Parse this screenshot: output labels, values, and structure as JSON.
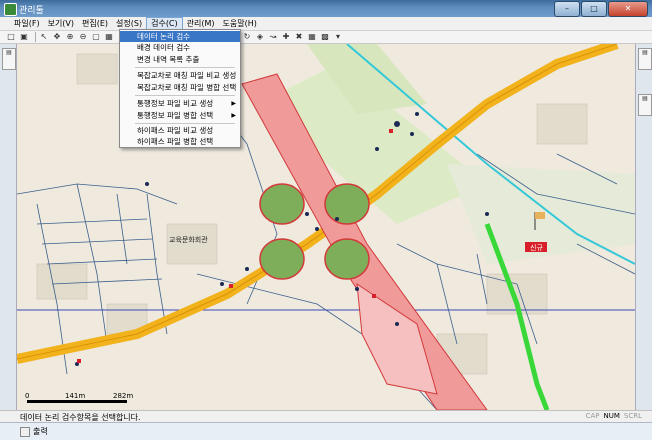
{
  "window": {
    "title": "관리툴"
  },
  "menu": {
    "items": [
      "파일(F)",
      "보기(V)",
      "편집(E)",
      "설정(S)",
      "검수(C)",
      "관리(M)",
      "도움말(H)"
    ],
    "active_index": 4
  },
  "inspect_menu": {
    "items": [
      {
        "label": "데이터 논리 검수",
        "selected": true
      },
      {
        "label": "배경 데이터 검수"
      },
      {
        "label": "변경 내역 목록 추출"
      },
      {
        "label": "복잡교차로 매칭 파일 비교 생성"
      },
      {
        "label": "복잡교차로 매칭 파일 병합 선택"
      },
      {
        "label": "통행정보 파일 비교 생성",
        "submenu": true
      },
      {
        "label": "통행정보 파일 병합 선택",
        "submenu": true
      },
      {
        "label": "하이패스 파일 비교 생성"
      },
      {
        "label": "하이패스 파일 병합 선택"
      }
    ]
  },
  "map": {
    "labels": {
      "edu_center": "교육문화회관",
      "interchange": "신규"
    },
    "scale": {
      "t0": "0",
      "t1": "141m",
      "t2": "282m"
    },
    "colors": {
      "highway": "#f2b21c",
      "ramp": "#e96a6a",
      "green": "#7fae5a",
      "rail": "#35c8d8",
      "newroad": "#38d838"
    }
  },
  "status": {
    "message": "데이터 논리 검수항목을 선택합니다.",
    "keys": [
      "CAP",
      "NUM",
      "SCRL"
    ],
    "active_keys": [
      "NUM"
    ]
  },
  "output": {
    "label": "출력"
  },
  "side_tabs": {
    "left": "레이어",
    "right_top": "속성",
    "right_mid": "검색"
  }
}
